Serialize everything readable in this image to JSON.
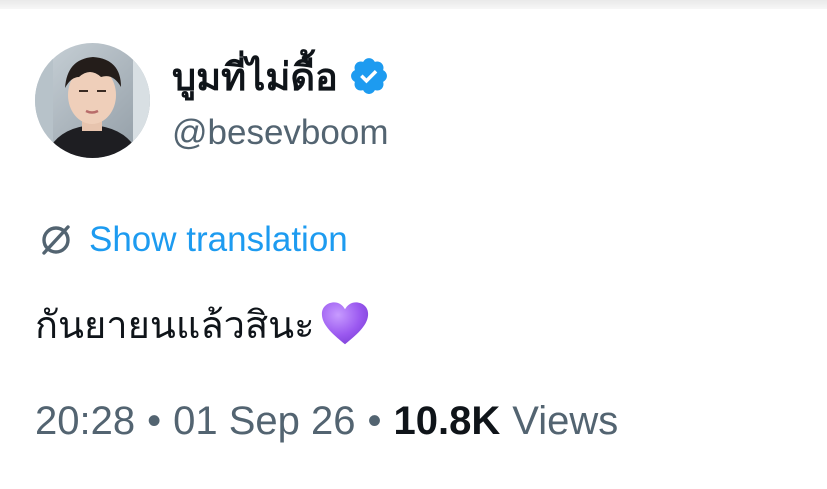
{
  "tweet": {
    "author": {
      "display_name": "บูมที่ไม่ดื้อ",
      "handle": "@besevboom",
      "verified": true,
      "verified_icon": "verified-badge-icon"
    },
    "translate": {
      "icon": "translate-icon",
      "label": "Show translation"
    },
    "text": "กันยายนแล้วสินะ",
    "emoji": "purple-heart-icon",
    "meta": {
      "time": "20:28",
      "separator": "•",
      "date": "01 Sep 26",
      "views_count": "10.8K",
      "views_label": "Views"
    }
  },
  "colors": {
    "link": "#1d9bf0",
    "secondary_text": "#536471",
    "primary_text": "#0f1419",
    "heart": "#9b59f0"
  }
}
